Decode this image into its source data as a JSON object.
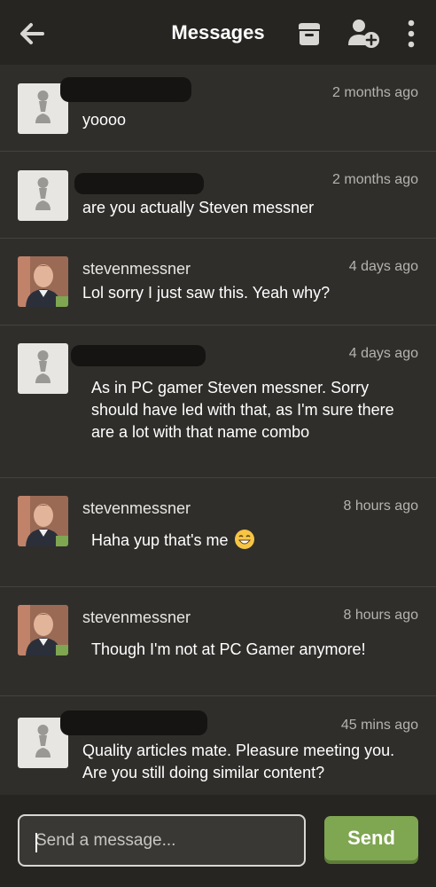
{
  "header": {
    "title": "Messages",
    "back_icon": "arrow-left-icon",
    "archive_icon": "archive-box-icon",
    "add_user_icon": "user-plus-icon",
    "more_icon": "more-vertical-icon"
  },
  "messages": [
    {
      "name": "",
      "time": "2 months ago",
      "text": "yoooo",
      "avatar": "pawn-avatar-icon"
    },
    {
      "name": "",
      "time": "2 months ago",
      "text": "are you actually Steven messner",
      "avatar": "pawn-avatar-icon"
    },
    {
      "name": "stevenmessner",
      "time": "4 days ago",
      "text": "Lol sorry I just saw this. Yeah why?",
      "avatar": "photo"
    },
    {
      "name": "",
      "time": "4 days ago",
      "text": "As in PC gamer Steven messner. Sorry should have led with that, as I'm sure there are a lot with that name combo",
      "avatar": "pawn-avatar-icon"
    },
    {
      "name": "stevenmessner",
      "time": "8 hours ago",
      "text": "Haha yup that's me",
      "avatar": "photo",
      "emoji": "grinning-face-emoji"
    },
    {
      "name": "stevenmessner",
      "time": "8 hours ago",
      "text": "Though I'm not at PC Gamer anymore!",
      "avatar": "photo"
    },
    {
      "name": "",
      "time": "45 mins ago",
      "text": "Quality articles mate. Pleasure meeting you. Are you still doing similar content?",
      "avatar": "pawn-avatar-icon"
    }
  ],
  "composer": {
    "placeholder": "Send a message...",
    "value": "",
    "send_label": "Send"
  },
  "colors": {
    "background": "#302e2b",
    "header": "#262522",
    "accent": "#7fa650",
    "text": "#ffffff",
    "muted": "#b5b3b0"
  }
}
